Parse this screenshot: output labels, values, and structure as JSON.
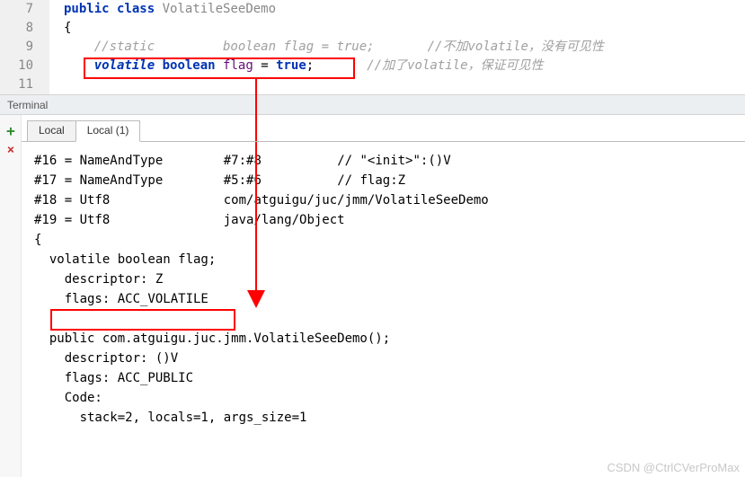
{
  "editor": {
    "lines": {
      "l7": {
        "no": "7",
        "kw_public": "public",
        "kw_class": "class",
        "name": "VolatileSeeDemo"
      },
      "l8": {
        "no": "8",
        "brace": "{"
      },
      "l9": {
        "no": "9",
        "comment1": "//static         boolean flag = true;",
        "comment2": "//不加volatile，没有可见性"
      },
      "l10": {
        "no": "10",
        "kw_volatile": "volatile",
        "kw_boolean": "boolean",
        "ident": "flag",
        "eq": " = ",
        "val": "true",
        "semi": ";",
        "comment": "//加了volatile，保证可见性"
      },
      "l11": {
        "no": "11"
      }
    }
  },
  "terminal": {
    "title": "Terminal",
    "tabs": {
      "t1": "Local",
      "t2": "Local (1)"
    },
    "icons": {
      "add": "+",
      "close": "×"
    },
    "output": {
      "row1a": "#16 = NameAndType",
      "row1b": "#7:#8",
      "row1c": "// \"<init>\":()V",
      "row2a": "#17 = NameAndType",
      "row2b": "#5:#6",
      "row2c": "// flag:Z",
      "row3a": "#18 = Utf8",
      "row3b": "com/atguigu/juc/jmm/VolatileSeeDemo",
      "row4a": "#19 = Utf8",
      "row4b": "java/lang/Object",
      "brace_open": "{",
      "decl": "  volatile boolean flag;",
      "desc1": "    descriptor: Z",
      "flags1": "    flags: ACC_VOLATILE",
      "blank": "",
      "ctor": "  public com.atguigu.juc.jmm.VolatileSeeDemo();",
      "desc2": "    descriptor: ()V",
      "flags2": "    flags: ACC_PUBLIC",
      "code_lbl": "    Code:",
      "stack": "      stack=2, locals=1, args_size=1"
    }
  },
  "watermark": "CSDN @CtrlCVerProMax"
}
